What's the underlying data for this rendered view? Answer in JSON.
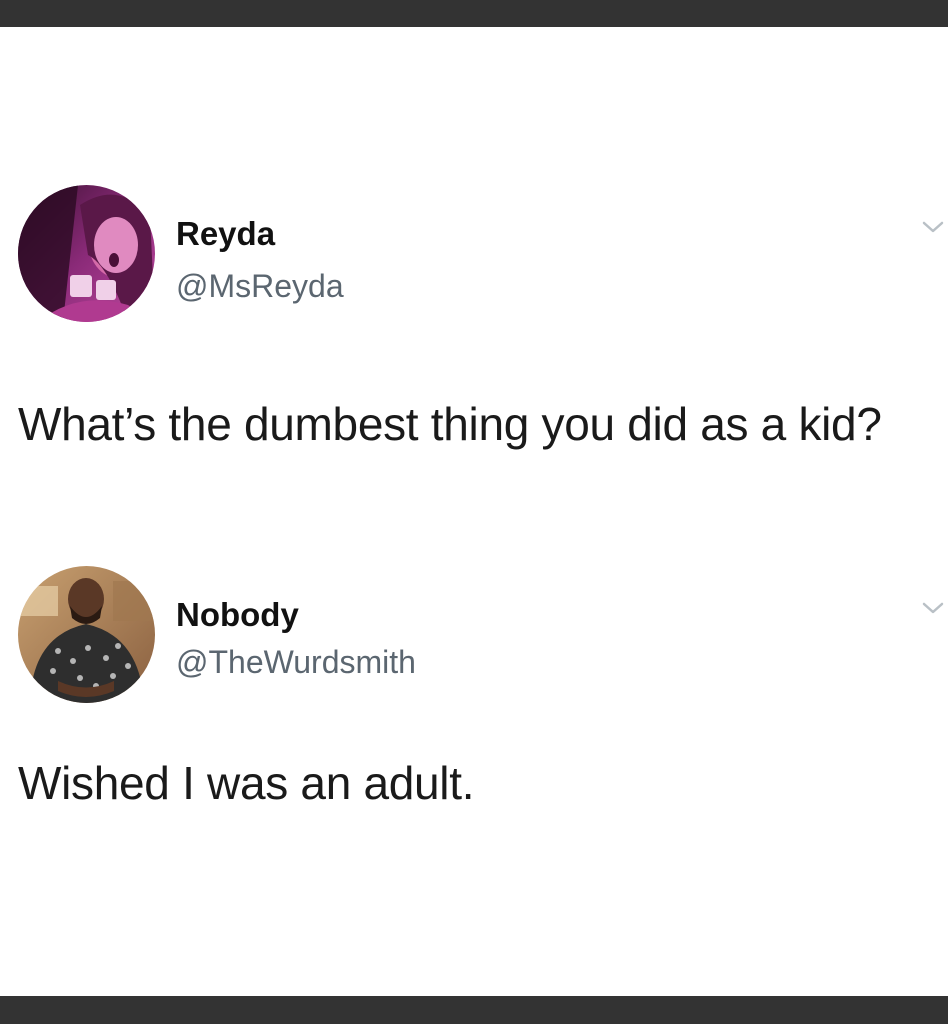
{
  "tweets": [
    {
      "display_name": "Reyda",
      "handle": "@MsReyda",
      "text": "What’s the dumbest thing you did as a kid?",
      "avatar_icon": "profile-photo-pink-portrait",
      "menu_icon": "chevron-down-icon"
    },
    {
      "display_name": "Nobody",
      "handle": "@TheWurdsmith",
      "text": "Wished I was an adult.",
      "avatar_icon": "profile-photo-man-portrait",
      "menu_icon": "chevron-down-icon"
    }
  ],
  "colors": {
    "frame": "#333333",
    "background": "#ffffff",
    "name": "#111111",
    "handle": "#5b6670",
    "text": "#1a1a1a",
    "chevron": "#b9c0c6"
  }
}
